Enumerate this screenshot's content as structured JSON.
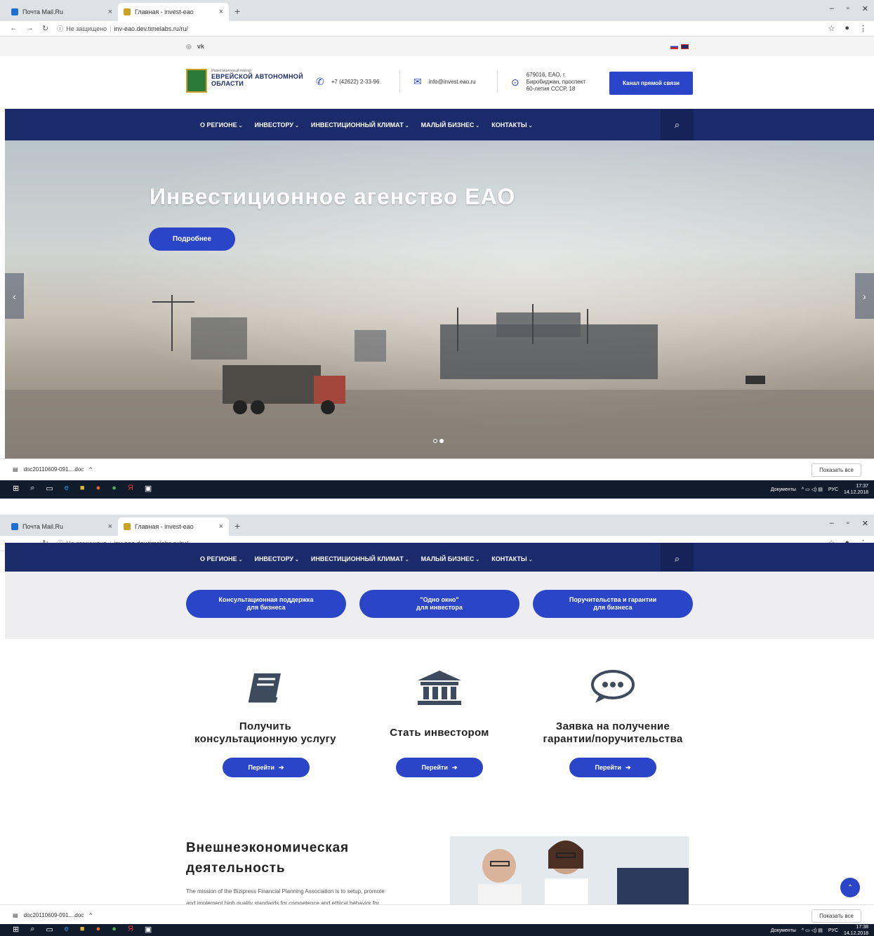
{
  "browser": {
    "tabs": [
      {
        "title": "Почта Mail.Ru"
      },
      {
        "title": "Главная - invest-eao"
      }
    ],
    "security_label": "Не защищено",
    "url": "inv-eao.dev.timelabs.ru/ru/"
  },
  "site": {
    "logo_small": "Инвестиционный портал",
    "logo_line1": "ЕВРЕЙСКОЙ АВТОНОМНОЙ",
    "logo_line2": "ОБЛАСТИ",
    "phone": "+7 (42622) 2-33-96",
    "email": "info@invest.eao.ru",
    "address_line1": "679016, ЕАО, г.",
    "address_line2": "Биробиджан, проспект",
    "address_line3": "60-летия СССР, 18",
    "hotline_button": "Канал прямой связи",
    "nav": [
      "О РЕГИОНЕ",
      "ИНВЕСТОРУ",
      "ИНВЕСТИЦИОННЫЙ КЛИМАТ",
      "МАЛЫЙ БИЗНЕС",
      "КОНТАКТЫ"
    ]
  },
  "hero": {
    "title": "Инвестиционное агенство ЕАО",
    "button": "Подробнее",
    "slides_total": 2,
    "slide_active": 2
  },
  "services": [
    {
      "line1": "Консультационная поддержка",
      "line2": "для бизнеса"
    },
    {
      "line1": "\"Одно окно\"",
      "line2": "для инвестора"
    },
    {
      "line1": "Поручительства и гарантии",
      "line2": "для бизнеса"
    }
  ],
  "features": [
    {
      "title_line1": "Получить",
      "title_line2": "консультационную услугу",
      "button": "Перейти",
      "icon": "book-icon"
    },
    {
      "title_line1": "Стать инвестором",
      "title_line2": "",
      "button": "Перейти",
      "icon": "bank-building-icon"
    },
    {
      "title_line1": "Заявка на получение",
      "title_line2": "гарантии/поручительства",
      "button": "Перейти",
      "icon": "chat-bubble-icon"
    }
  ],
  "foreign": {
    "title_line1": "Внешнеэкономическая",
    "title_line2": "деятельность",
    "text_line1": "The mission of the Bizipress Financial Planning Association is to setup, promote",
    "text_line2": "and implement high quality standards for competence and ethical behavior for"
  },
  "downloads": {
    "file": "doc20110609-091....doc",
    "show_all": "Показать все"
  },
  "taskbar": {
    "documents_label": "Документы",
    "lang": "РУС",
    "time1": "17:37",
    "date1": "14.12.2018",
    "time2": "17:38",
    "date2": "14.12.2018"
  },
  "colors": {
    "nav_bg": "#1b2a6b",
    "accent": "#2b45c8",
    "services_bg": "#eeeef1"
  }
}
